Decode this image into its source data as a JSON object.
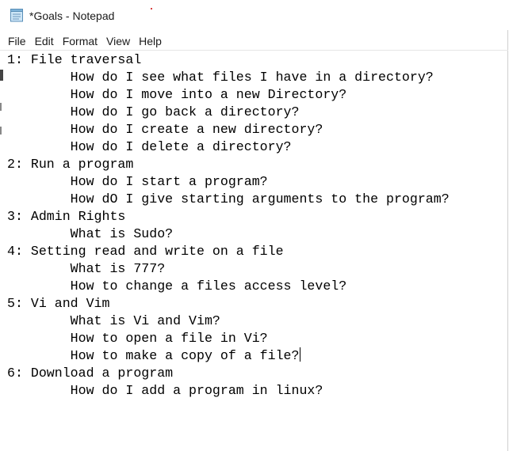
{
  "window": {
    "title": "*Goals - Notepad"
  },
  "menu": [
    "File",
    "Edit",
    "Format",
    "View",
    "Help"
  ],
  "document": {
    "lines": [
      "1: File traversal",
      "\tHow do I see what files I have in a directory?",
      "\tHow do I move into a new Directory?",
      "\tHow do I go back a directory?",
      "\tHow do I create a new directory?",
      "\tHow do I delete a directory?",
      "2: Run a program",
      "\tHow do I start a program?",
      "\tHow dO I give starting arguments to the program?",
      "3: Admin Rights",
      "\tWhat is Sudo?",
      "4: Setting read and write on a file",
      "\tWhat is 777?",
      "\tHow to change a files access level?",
      "5: Vi and Vim",
      "\tWhat is Vi and Vim?",
      "\tHow to open a file in Vi?",
      "\tHow to make a copy of a file?",
      "6: Download a program",
      "\tHow do I add a program in linux?"
    ],
    "caret_line": 17
  },
  "icons": {
    "app_icon": "notepad-icon"
  }
}
